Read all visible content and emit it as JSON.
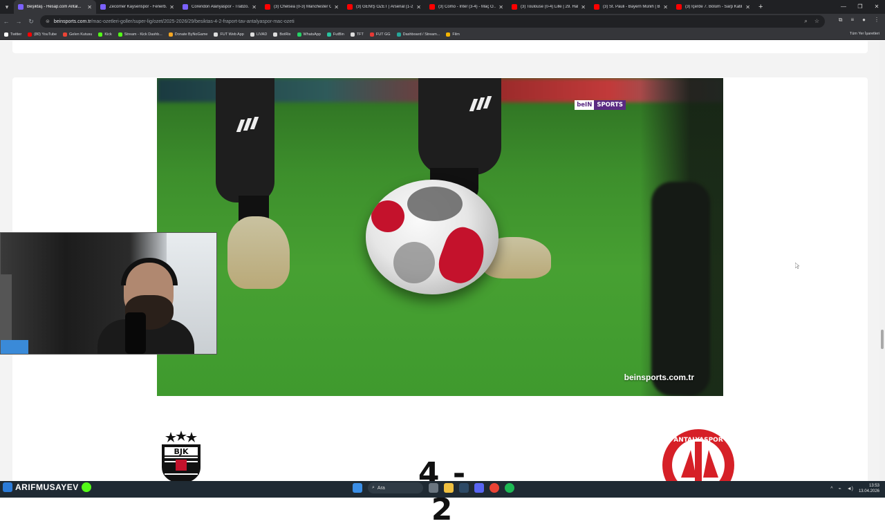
{
  "tabs": [
    {
      "title": "Beşiktaş - Hesap.com Antal...",
      "color": "#7b61ff",
      "active": true
    },
    {
      "title": "Zecorner Kayserispor - Fenerb...",
      "color": "#7b61ff",
      "active": false
    },
    {
      "title": "Corendon Alanyaspor - Trabzo...",
      "color": "#7b61ff",
      "active": false
    },
    {
      "title": "(3) Chelsea (0-3) Manchester C...",
      "color": "#ff0000",
      "active": false
    },
    {
      "title": "(3) GENİŞ ÖZET | Arsenal (1-2)...",
      "color": "#ff0000",
      "active": false
    },
    {
      "title": "(3) Como - Inter (3-4) - Maç Ö...",
      "color": "#ff0000",
      "active": false
    },
    {
      "title": "(3) Toulouse (0-4) Lille | 29. Haf...",
      "color": "#ff0000",
      "active": false
    },
    {
      "title": "(3) St. Pauli - Bayern Münih | B...",
      "color": "#ff0000",
      "active": false
    },
    {
      "title": "(3) İçerde 7. Bölüm - Sarp Katil...",
      "color": "#ff0000",
      "active": false
    }
  ],
  "address": {
    "host": "beinsports.com.tr",
    "path": "/mac-ozetleri-goller/super-lig/ozet/2025-2026/29/besiktas-4-2-fraport-tav-antalyaspor-mac-ozeti"
  },
  "bookmarks": [
    {
      "label": "Twitter",
      "color": "#ffffff"
    },
    {
      "label": "(80) YouTube",
      "color": "#ff0000"
    },
    {
      "label": "Gelen Kutusu",
      "color": "#ea4335"
    },
    {
      "label": "Kick",
      "color": "#53fc18"
    },
    {
      "label": "Stream - Kick Dashb...",
      "color": "#53fc18"
    },
    {
      "label": "Donate ByNoGame",
      "color": "#f5a623"
    },
    {
      "label": "FUT Web App",
      "color": "#dddddd"
    },
    {
      "label": "LIVAD",
      "color": "#dddddd"
    },
    {
      "label": "BotRix",
      "color": "#dddddd"
    },
    {
      "label": "WhatsApp",
      "color": "#25d366"
    },
    {
      "label": "FutBin",
      "color": "#29c3a0"
    },
    {
      "label": "TFT",
      "color": "#dddddd"
    },
    {
      "label": "FUT GG",
      "color": "#e53935"
    },
    {
      "label": "Dashboard / Stream...",
      "color": "#26a69a"
    },
    {
      "label": "Film",
      "color": "#f4b400"
    }
  ],
  "bookmarks_right": "Tüm Yer İşaretleri",
  "video": {
    "badge_a": "beIN",
    "badge_b": "SPORTS",
    "watermark": "beinsports.com.tr"
  },
  "match": {
    "score": "4 - 2",
    "home_team": "BJK",
    "away_team": "ANTALYASPOR"
  },
  "taskbar": {
    "username": "ARIFMUSAYEV",
    "search_placeholder": "Ara",
    "time": "13:53",
    "date": "13.04.2026"
  }
}
